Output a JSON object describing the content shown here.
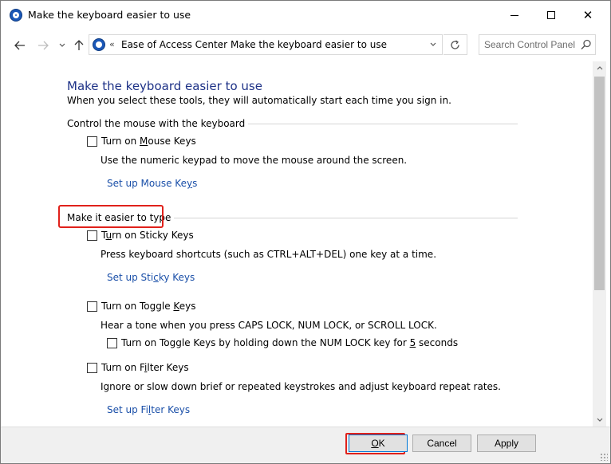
{
  "window": {
    "title": "Make the keyboard easier to use",
    "minimize_icon": "minimize-icon",
    "maximize_icon": "maximize-icon",
    "close_icon": "close-icon"
  },
  "nav": {
    "back_icon": "back-arrow-icon",
    "forward_icon": "forward-arrow-icon",
    "recent_icon": "chevron-down-icon",
    "up_icon": "up-arrow-icon"
  },
  "address": {
    "breadcrumb_prefix": "«",
    "crumbs": [
      "Ease of Access Center",
      "Make the keyboard easier to use"
    ],
    "separator": "›"
  },
  "search": {
    "placeholder": "Search Control Panel"
  },
  "page": {
    "title": "Make the keyboard easier to use",
    "description": "When you select these tools, they will automatically start each time you sign in."
  },
  "sections": {
    "mouse": {
      "header": "Control the mouse with the keyboard",
      "mouse_keys": {
        "label_pre": "Turn on ",
        "label_key": "M",
        "label_post": "ouse Keys",
        "checked": false,
        "description": "Use the numeric keypad to move the mouse around the screen.",
        "link_pre": "Set up Mouse Ke",
        "link_key": "y",
        "link_post": "s"
      }
    },
    "typing": {
      "header": "Make it easier to type",
      "sticky_keys": {
        "label_pre": "T",
        "label_key": "u",
        "label_post": "rn on Sticky Keys",
        "checked": false,
        "description": "Press keyboard shortcuts (such as CTRL+ALT+DEL) one key at a time.",
        "link_pre": "Set up Sti",
        "link_key": "c",
        "link_post": "ky Keys"
      },
      "toggle_keys": {
        "label_pre": "Turn on Toggle ",
        "label_key": "K",
        "label_post": "eys",
        "checked": false,
        "description": "Hear a tone when you press CAPS LOCK, NUM LOCK, or SCROLL LOCK.",
        "sub_pre": "Turn on Toggle Keys by holding down the NUM LOCK key for ",
        "sub_key": "5",
        "sub_post": " seconds",
        "sub_checked": false
      },
      "filter_keys": {
        "label_pre": "Turn on F",
        "label_key": "i",
        "label_post": "lter Keys",
        "checked": false,
        "description": "Ignore or slow down brief or repeated keystrokes and adjust keyboard repeat rates.",
        "link_pre": "Set up Fi",
        "link_key": "l",
        "link_post": "ter Keys"
      }
    }
  },
  "footer": {
    "ok_pre": "",
    "ok_key": "O",
    "ok_post": "K",
    "cancel": "Cancel",
    "apply": "Apply"
  },
  "colors": {
    "title_blue": "#1e3287",
    "link_blue": "#1a4fa8",
    "highlight_red": "#e0211b"
  }
}
